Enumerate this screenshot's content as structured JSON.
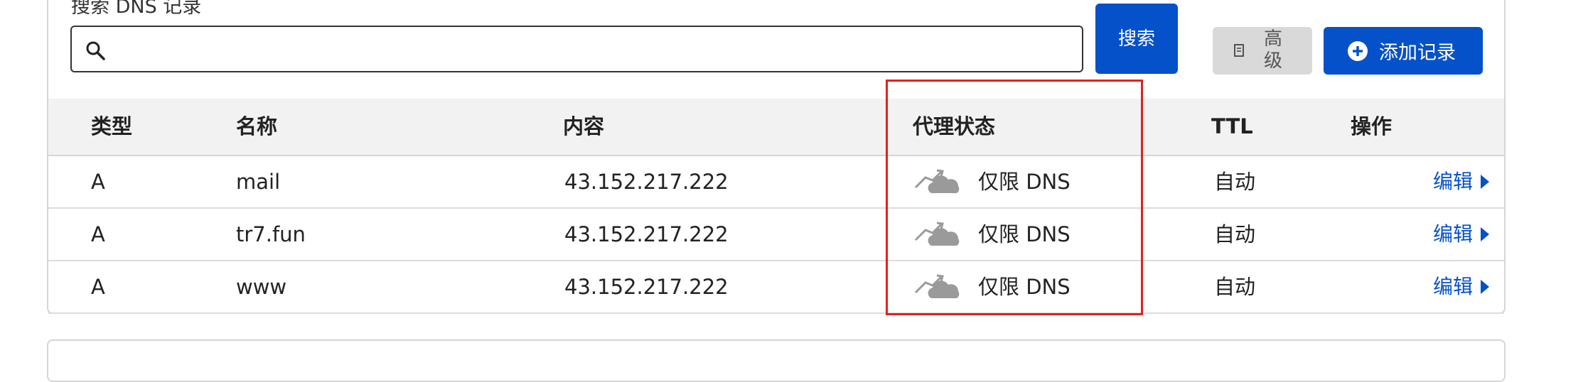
{
  "search": {
    "label": "搜索 DNS 记录",
    "value": "",
    "placeholder": "",
    "button_label": "搜索"
  },
  "toolbar": {
    "advanced_label": "高级",
    "add_label": "添加记录"
  },
  "table": {
    "headers": {
      "type": "类型",
      "name": "名称",
      "content": "内容",
      "proxy": "代理状态",
      "ttl": "TTL",
      "actions": "操作"
    },
    "rows": [
      {
        "type": "A",
        "name": "mail",
        "content": "43.152.217.222",
        "proxy": "仅限 DNS",
        "ttl": "自动",
        "edit": "编辑"
      },
      {
        "type": "A",
        "name": "tr7.fun",
        "content": "43.152.217.222",
        "proxy": "仅限 DNS",
        "ttl": "自动",
        "edit": "编辑"
      },
      {
        "type": "A",
        "name": "www",
        "content": "43.152.217.222",
        "proxy": "仅限 DNS",
        "ttl": "自动",
        "edit": "编辑"
      }
    ]
  },
  "colors": {
    "primary": "#0551c9",
    "highlight": "#e3201b",
    "cloud_gray": "#9a9a9a"
  },
  "icons": {
    "search": "search-icon",
    "advanced": "document-icon",
    "add": "plus-circle-icon",
    "proxy": "dns-only-cloud-icon",
    "edit": "caret-right-icon"
  }
}
